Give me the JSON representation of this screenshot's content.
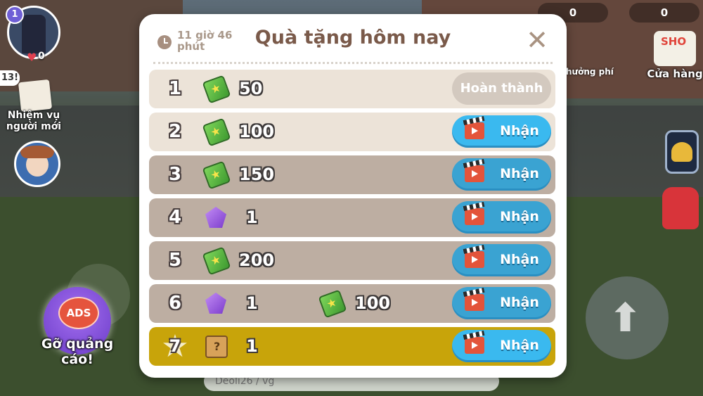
{
  "hud": {
    "level": "1",
    "likes": "0",
    "quest_count": "13!",
    "quest_label": "Nhiệm vụ người mới",
    "ads_badge": "ADS",
    "ads_label": "Gỡ quảng cáo!",
    "currency_a": "0",
    "currency_b": "0",
    "shop_sign": "SHO",
    "shop_label": "Cửa hàng",
    "free_label": "hưởng phí",
    "chat_placeholder": "Deoli26 / vg"
  },
  "dialog": {
    "title": "Quà tặng hôm nay",
    "timer": "11 giờ 46 phút",
    "rows": [
      {
        "index": "1",
        "rewards": [
          {
            "icon": "cash-icon",
            "amount": "50"
          }
        ],
        "button": "Hoàn thành",
        "state": "claimed"
      },
      {
        "index": "2",
        "rewards": [
          {
            "icon": "cash-icon",
            "amount": "100"
          }
        ],
        "button": "Nhận",
        "state": "active"
      },
      {
        "index": "3",
        "rewards": [
          {
            "icon": "cash-icon",
            "amount": "150"
          }
        ],
        "button": "Nhận",
        "state": "locked"
      },
      {
        "index": "4",
        "rewards": [
          {
            "icon": "gem-icon",
            "amount": "1"
          }
        ],
        "button": "Nhận",
        "state": "locked"
      },
      {
        "index": "5",
        "rewards": [
          {
            "icon": "cash-icon",
            "amount": "200"
          }
        ],
        "button": "Nhận",
        "state": "locked"
      },
      {
        "index": "6",
        "rewards": [
          {
            "icon": "gem-icon",
            "amount": "1"
          },
          {
            "icon": "cash-icon",
            "amount": "100"
          }
        ],
        "button": "Nhận",
        "state": "locked"
      },
      {
        "index": "7",
        "rewards": [
          {
            "icon": "mystery-box-icon",
            "amount": "1"
          }
        ],
        "button": "Nhận",
        "state": "special"
      }
    ]
  },
  "colors": {
    "accent_button": "#3ab9ef",
    "title": "#7a5a4a",
    "special_row": "#c8a40a"
  }
}
